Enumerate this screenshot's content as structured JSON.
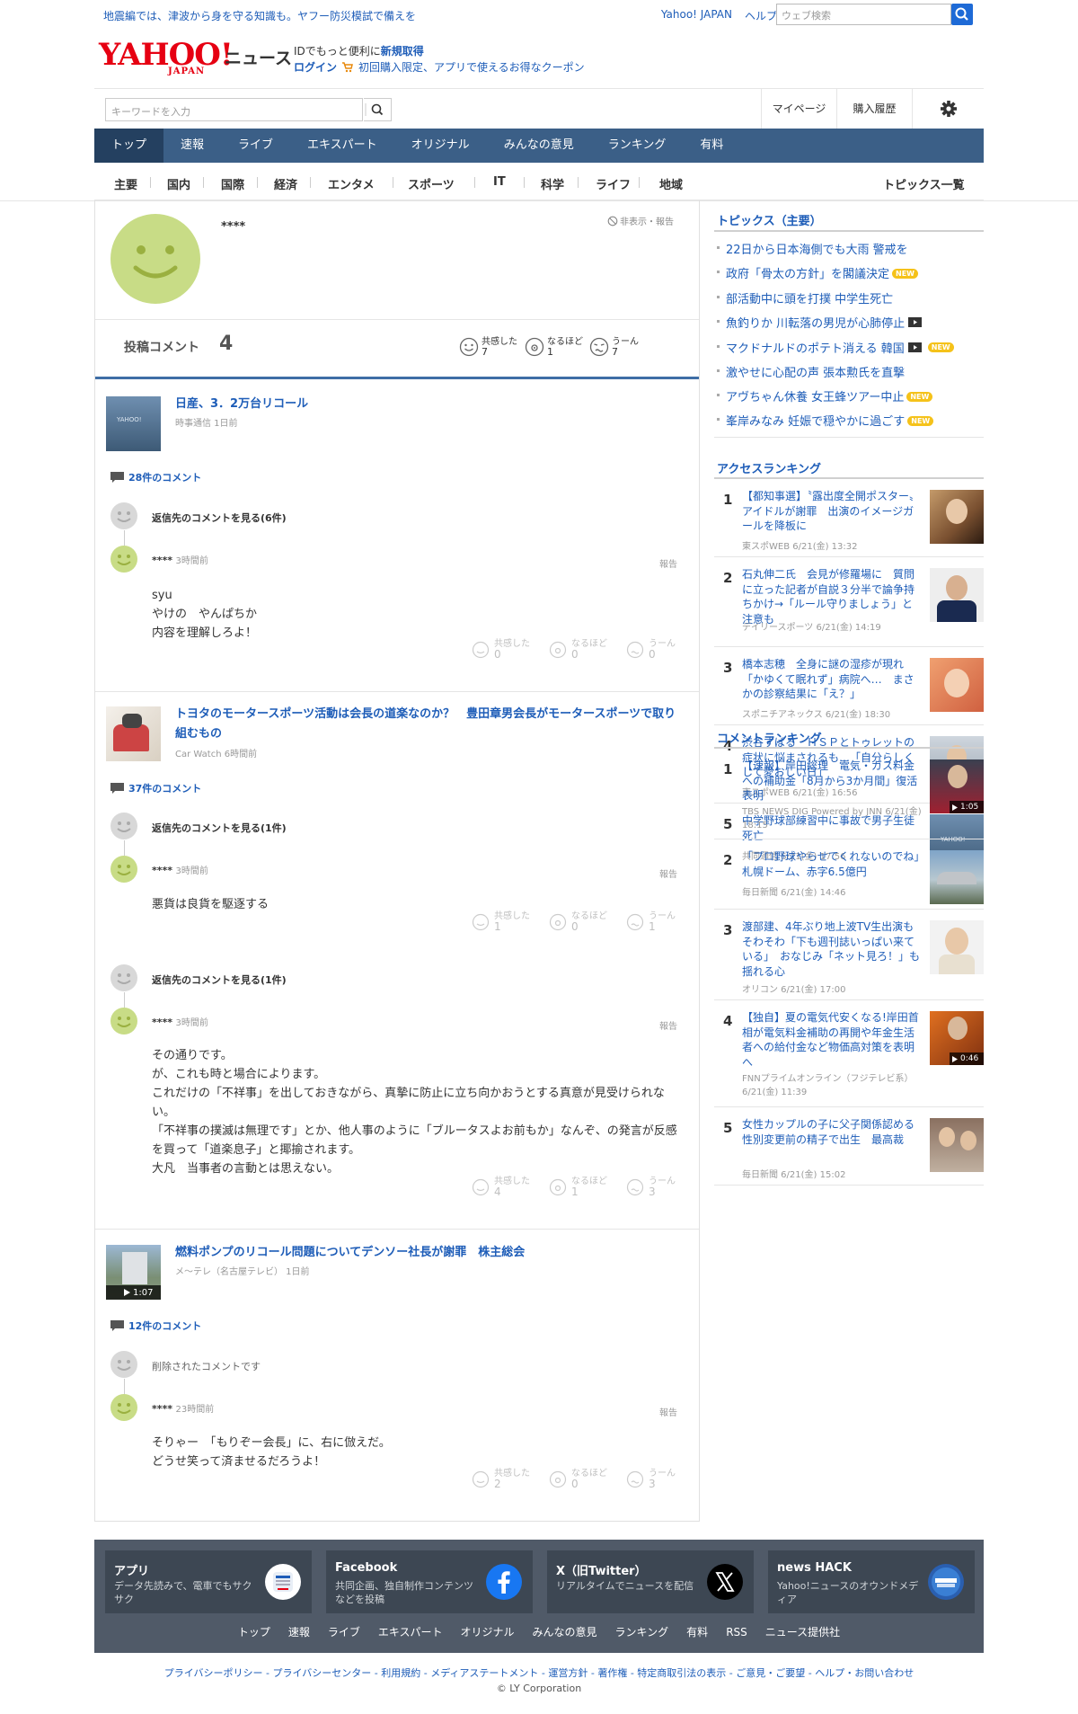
{
  "top": {
    "message": "地震編では、津波から身を守る知識も。ヤフー防災模試で備えを",
    "yahoo_japan": "Yahoo! JAPAN",
    "help": "ヘルプ",
    "web_search_placeholder": "ウェブ検索"
  },
  "brand": {
    "logo_text": "YAHOO!",
    "logo_sub": "JAPAN",
    "news": "ニュース",
    "promo_prefix": "IDでもっと便利に",
    "promo_link": "新規取得",
    "login": "ログイン",
    "coupon": "初回購入限定、アプリで使えるお得なクーポン"
  },
  "search": {
    "placeholder": "キーワードを入力",
    "mypage": "マイページ",
    "history": "購入履歴"
  },
  "gnav": [
    "トップ",
    "速報",
    "ライブ",
    "エキスパート",
    "オリジナル",
    "みんなの意見",
    "ランキング",
    "有料"
  ],
  "cnav": [
    "主要",
    "国内",
    "国際",
    "経済",
    "エンタメ",
    "スポーツ",
    "IT",
    "科学",
    "ライフ",
    "地域"
  ],
  "cnav_all": "トピックス一覧",
  "profile": {
    "name": "****",
    "hide_report": "非表示・報告",
    "posted_label": "投稿コメント",
    "posted_count": "4",
    "reactions": [
      {
        "label": "共感した",
        "count": "7"
      },
      {
        "label": "なるほど",
        "count": "1"
      },
      {
        "label": "うーん",
        "count": "7"
      }
    ]
  },
  "articles": [
    {
      "title": "日産、3．2万台リコール",
      "source": "時事通信 1日前",
      "comments_link": "28件のコメント",
      "threads": [
        {
          "reply_link": "返信先のコメントを見る(6件)",
          "user": "****",
          "time": "3時間前",
          "report": "報告",
          "lines": [
            "syu",
            "やけの　やんぱちか",
            "内容を理解しろよ！"
          ],
          "reactions": [
            {
              "label": "共感した",
              "count": "0"
            },
            {
              "label": "なるほど",
              "count": "0"
            },
            {
              "label": "うーん",
              "count": "0"
            }
          ]
        }
      ]
    },
    {
      "title": "トヨタのモータースポーツ活動は会長の道楽なのか？　豊田章男会長がモータースポーツで取り組むもの",
      "source": "Car Watch 6時間前",
      "comments_link": "37件のコメント",
      "threads": [
        {
          "reply_link": "返信先のコメントを見る(1件)",
          "user": "****",
          "time": "3時間前",
          "report": "報告",
          "lines": [
            "悪貨は良貨を駆逐する"
          ],
          "reactions": [
            {
              "label": "共感した",
              "count": "1"
            },
            {
              "label": "なるほど",
              "count": "0"
            },
            {
              "label": "うーん",
              "count": "1"
            }
          ]
        },
        {
          "reply_link": "返信先のコメントを見る(1件)",
          "user": "****",
          "time": "3時間前",
          "report": "報告",
          "lines": [
            "その通りです。",
            "が、これも時と場合によります。",
            "これだけの「不祥事」を出しておきながら、真摯に防止に立ち向かおうとする真意が見受けられない。",
            "「不祥事の撲滅は無理です」とか、他人事のように「ブルータスよお前もか」なんぞ、の発言が反感を買って「道楽息子」と揶揄されます。",
            "大凡　当事者の言動とは思えない。"
          ],
          "reactions": [
            {
              "label": "共感した",
              "count": "4"
            },
            {
              "label": "なるほど",
              "count": "1"
            },
            {
              "label": "うーん",
              "count": "3"
            }
          ]
        }
      ]
    },
    {
      "title": "燃料ポンプのリコール問題についてデンソー社長が謝罪　株主総会",
      "source": "メ～テレ（名古屋テレビ） 1日前",
      "video_duration": "1:07",
      "comments_link": "12件のコメント",
      "threads": [
        {
          "reply_link": "削除されたコメントです",
          "user": "****",
          "time": "23時間前",
          "report": "報告",
          "lines": [
            "そりゃー　「もりぞー会長」に、右に倣えだ。",
            "どうせ笑って済ませるだろうよ！"
          ],
          "reactions": [
            {
              "label": "共感した",
              "count": "2"
            },
            {
              "label": "なるほど",
              "count": "0"
            },
            {
              "label": "うーん",
              "count": "3"
            }
          ]
        }
      ]
    }
  ],
  "topics": {
    "heading": "トピックス（主要）",
    "new_badge": "NEW",
    "items": [
      {
        "text": "22日から日本海側でも大雨 警戒を",
        "new": false,
        "video": false
      },
      {
        "text": "政府「骨太の方針」を閣議決定",
        "new": true,
        "video": false
      },
      {
        "text": "部活動中に頭を打撲 中学生死亡",
        "new": false,
        "video": false
      },
      {
        "text": "魚釣りか 川転落の男児が心肺停止",
        "new": false,
        "video": true
      },
      {
        "text": "マクドナルドのポテト消える 韓国",
        "new": true,
        "video": true
      },
      {
        "text": "激やせに心配の声 張本勲氏を直撃",
        "new": false,
        "video": false
      },
      {
        "text": "アヴちゃん休養 女王蜂ツアー中止",
        "new": true,
        "video": false
      },
      {
        "text": "峯岸みなみ 妊娠で穏やかに過ごす",
        "new": true,
        "video": false
      }
    ]
  },
  "access_ranking": {
    "heading": "アクセスランキング",
    "items": [
      {
        "rank": "1",
        "title": "【都知事選】〝露出度全開ポスター〟アイドルが謝罪　出演のイメージガールを降板に",
        "source": "東スポWEB 6/21(金) 13:32"
      },
      {
        "rank": "2",
        "title": "石丸伸二氏　会見が修羅場に　質問に立った記者が自説３分半で論争持ちかけ→「ルール守りましょう」と注意も",
        "source": "デイリースポーツ 6/21(金) 14:19"
      },
      {
        "rank": "3",
        "title": "橋本志穂　全身に謎の湿疹が現れ「かゆくて眠れず」病院へ…　まさかの診察結果に「え？」",
        "source": "スポニチアネックス 6/21(金) 18:30"
      },
      {
        "rank": "4",
        "title": "渋谷すばる　ＨＳＰとトゥレットの症状に悩まされるも…「自分らしくして愛おしい日」",
        "source": "東スポWEB 6/21(金) 16:56"
      },
      {
        "rank": "5",
        "title": "中学野球部練習中に事故で男子生徒死亡",
        "source": "共同通信 6/21(金) 17:56"
      }
    ]
  },
  "comment_ranking": {
    "heading": "コメントランキング",
    "items": [
      {
        "rank": "1",
        "title": "【速報】岸田総理　電気・ガス料金への補助金「8月から3か月間」復活表明",
        "source": "TBS NEWS DIG Powered by JNN 6/21(金) 18:15",
        "duration": "1:05"
      },
      {
        "rank": "2",
        "title": "「プロ野球やらせてくれないのでね」　札幌ドーム、赤字6.5億円",
        "source": "毎日新聞 6/21(金) 14:46",
        "duration": ""
      },
      {
        "rank": "3",
        "title": "渡部建、4年ぶり地上波TV生出演もそわそわ「下も週刊誌いっぱい来ている」　おなじみ「ネット見ろ！」も揺れる心",
        "source": "オリコン 6/21(金) 17:00",
        "duration": ""
      },
      {
        "rank": "4",
        "title": "【独自】夏の電気代安くなる!岸田首相が電気料金補助の再開や年金生活者への給付金など物価高対策を表明へ",
        "source": "FNNプライムオンライン（フジテレビ系） 6/21(金) 11:39",
        "duration": "0:46"
      },
      {
        "rank": "5",
        "title": "女性カップルの子に父子関係認める　性別変更前の精子で出生　最高裁",
        "source": "毎日新聞 6/21(金) 15:02",
        "duration": ""
      }
    ]
  },
  "footer": {
    "cards": [
      {
        "title": "アプリ",
        "desc": "データ先読みで、電車でもサクサク"
      },
      {
        "title": "Facebook",
        "desc": "共同企画、独自制作コンテンツなどを投稿"
      },
      {
        "title": "X（旧Twitter）",
        "desc": "リアルタイムでニュースを配信"
      },
      {
        "title": "news HACK",
        "desc": "Yahoo!ニュースのオウンドメディア"
      }
    ],
    "links": [
      "トップ",
      "速報",
      "ライブ",
      "エキスパート",
      "オリジナル",
      "みんなの意見",
      "ランキング",
      "有料",
      "RSS",
      "ニュース提供社"
    ],
    "legal": "プライバシーポリシー - プライバシーセンター - 利用規約 - メディアステートメント - 運営方針 - 著作権 - 特定商取引法の表示 - ご意見・ご要望 - ヘルプ・お問い合わせ",
    "copyright": "© LY Corporation"
  },
  "colors": {
    "link": "#1e5db8",
    "nav": "#3b5f87",
    "nav_active": "#244060",
    "accent_red": "#e60012",
    "new_badge": "#f5c21a",
    "face": "#c8dc86"
  }
}
